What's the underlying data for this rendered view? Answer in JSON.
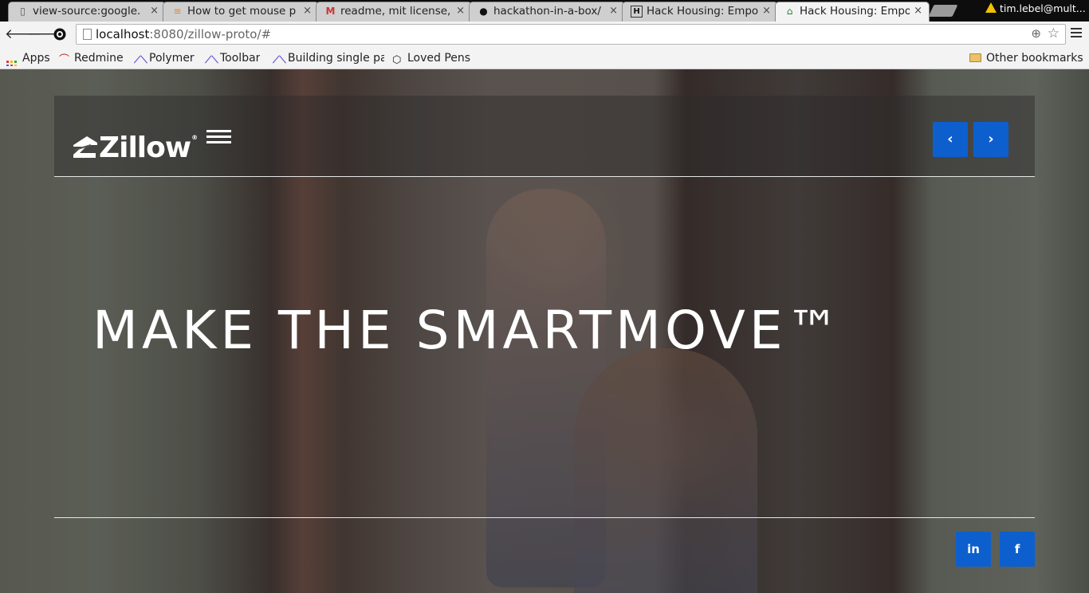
{
  "browser": {
    "tabs": [
      {
        "title": "view-source:google.",
        "icon": "page-icon",
        "close": "×"
      },
      {
        "title": "How to get mouse p",
        "icon": "stackoverflow-icon",
        "close": "×"
      },
      {
        "title": "readme, mit license,",
        "icon": "gmail-icon",
        "close": "×"
      },
      {
        "title": "hackathon-in-a-box/",
        "icon": "github-icon",
        "close": "×"
      },
      {
        "title": "Hack Housing: Empo",
        "icon": "h-icon",
        "close": "×"
      },
      {
        "title": "Hack Housing: Empo",
        "icon": "zillow-icon",
        "close": "×"
      }
    ],
    "profile_name": "tim.lebel@mult...",
    "url_host": "localhost",
    "url_path": ":8080/zillow-proto/#",
    "bookmarks": [
      {
        "label": "Apps",
        "icon": "apps-grid-icon"
      },
      {
        "label": "Redmine",
        "icon": "redmine-icon"
      },
      {
        "label": "Polymer",
        "icon": "polymer-icon"
      },
      {
        "label": "Toolbar",
        "icon": "polymer-icon"
      },
      {
        "label": "Building single pa",
        "icon": "polymer-icon"
      },
      {
        "label": "Loved Pens",
        "icon": "codepen-icon"
      }
    ],
    "other_bookmarks": "Other bookmarks",
    "back_glyph": "🡐",
    "forward_glyph": "🡒"
  },
  "page": {
    "logo_text": "Zillow",
    "logo_reg": "®",
    "prev_glyph": "‹",
    "next_glyph": "›",
    "hero_title": "MAKE THE SMARTMOVE™",
    "social": {
      "linkedin": "in",
      "facebook": "f"
    },
    "accent_color": "#0d5fce"
  }
}
